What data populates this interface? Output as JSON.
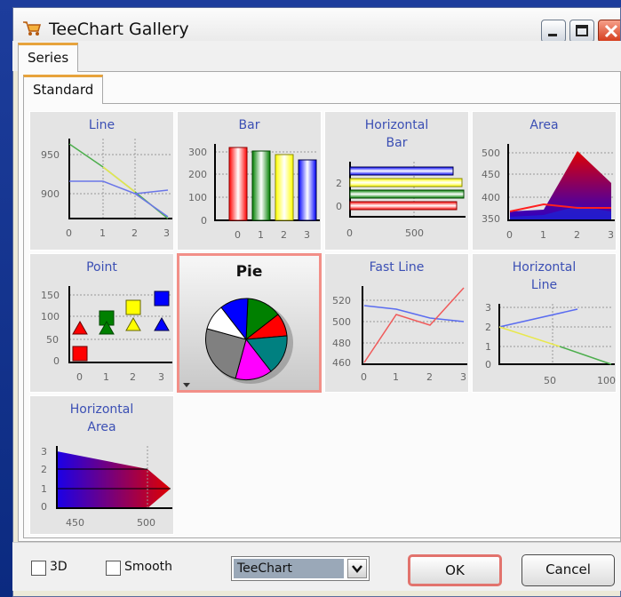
{
  "window": {
    "title": "TeeChart Gallery",
    "app_icon": "shopping-cart-icon"
  },
  "tabs": {
    "outer": "Series",
    "inner": "Standard"
  },
  "gallery": {
    "line": "Line",
    "bar": "Bar",
    "hbar_1": "Horizontal",
    "hbar_2": "Bar",
    "area": "Area",
    "point": "Point",
    "pie": "Pie",
    "fastline": "Fast Line",
    "hline_1": "Horizontal",
    "hline_2": "Line",
    "harea_1": "Horizontal",
    "harea_2": "Area",
    "ticks": {
      "line_y": [
        "950",
        "900"
      ],
      "x0123": [
        "0",
        "1",
        "2",
        "3"
      ],
      "bar_y": [
        "300",
        "200",
        "100",
        "0"
      ],
      "hbar_y": [
        "2",
        "0"
      ],
      "hbar_x": [
        "0",
        "500"
      ],
      "area_y": [
        "500",
        "450",
        "400",
        "350"
      ],
      "point_y": [
        "150",
        "100",
        "50",
        "0"
      ],
      "fastline_y": [
        "520",
        "500",
        "480",
        "460"
      ],
      "hline_y": [
        "3",
        "2",
        "1",
        "0"
      ],
      "hline_x": [
        "50",
        "100"
      ],
      "harea_y": [
        "3",
        "2",
        "1",
        "0"
      ],
      "harea_x": [
        "450",
        "500"
      ]
    }
  },
  "colors": {
    "label": "#3b4fb4",
    "selected_border": "#f28f88",
    "red": "#ff0000",
    "green": "#008000",
    "yellow": "#ffff00",
    "blue": "#0000ff",
    "teal": "#008080",
    "magenta": "#ff00ff"
  },
  "footer": {
    "check_3d": "3D",
    "check_smooth": "Smooth",
    "combo_value": "TeeChart",
    "ok": "OK",
    "cancel": "Cancel"
  }
}
